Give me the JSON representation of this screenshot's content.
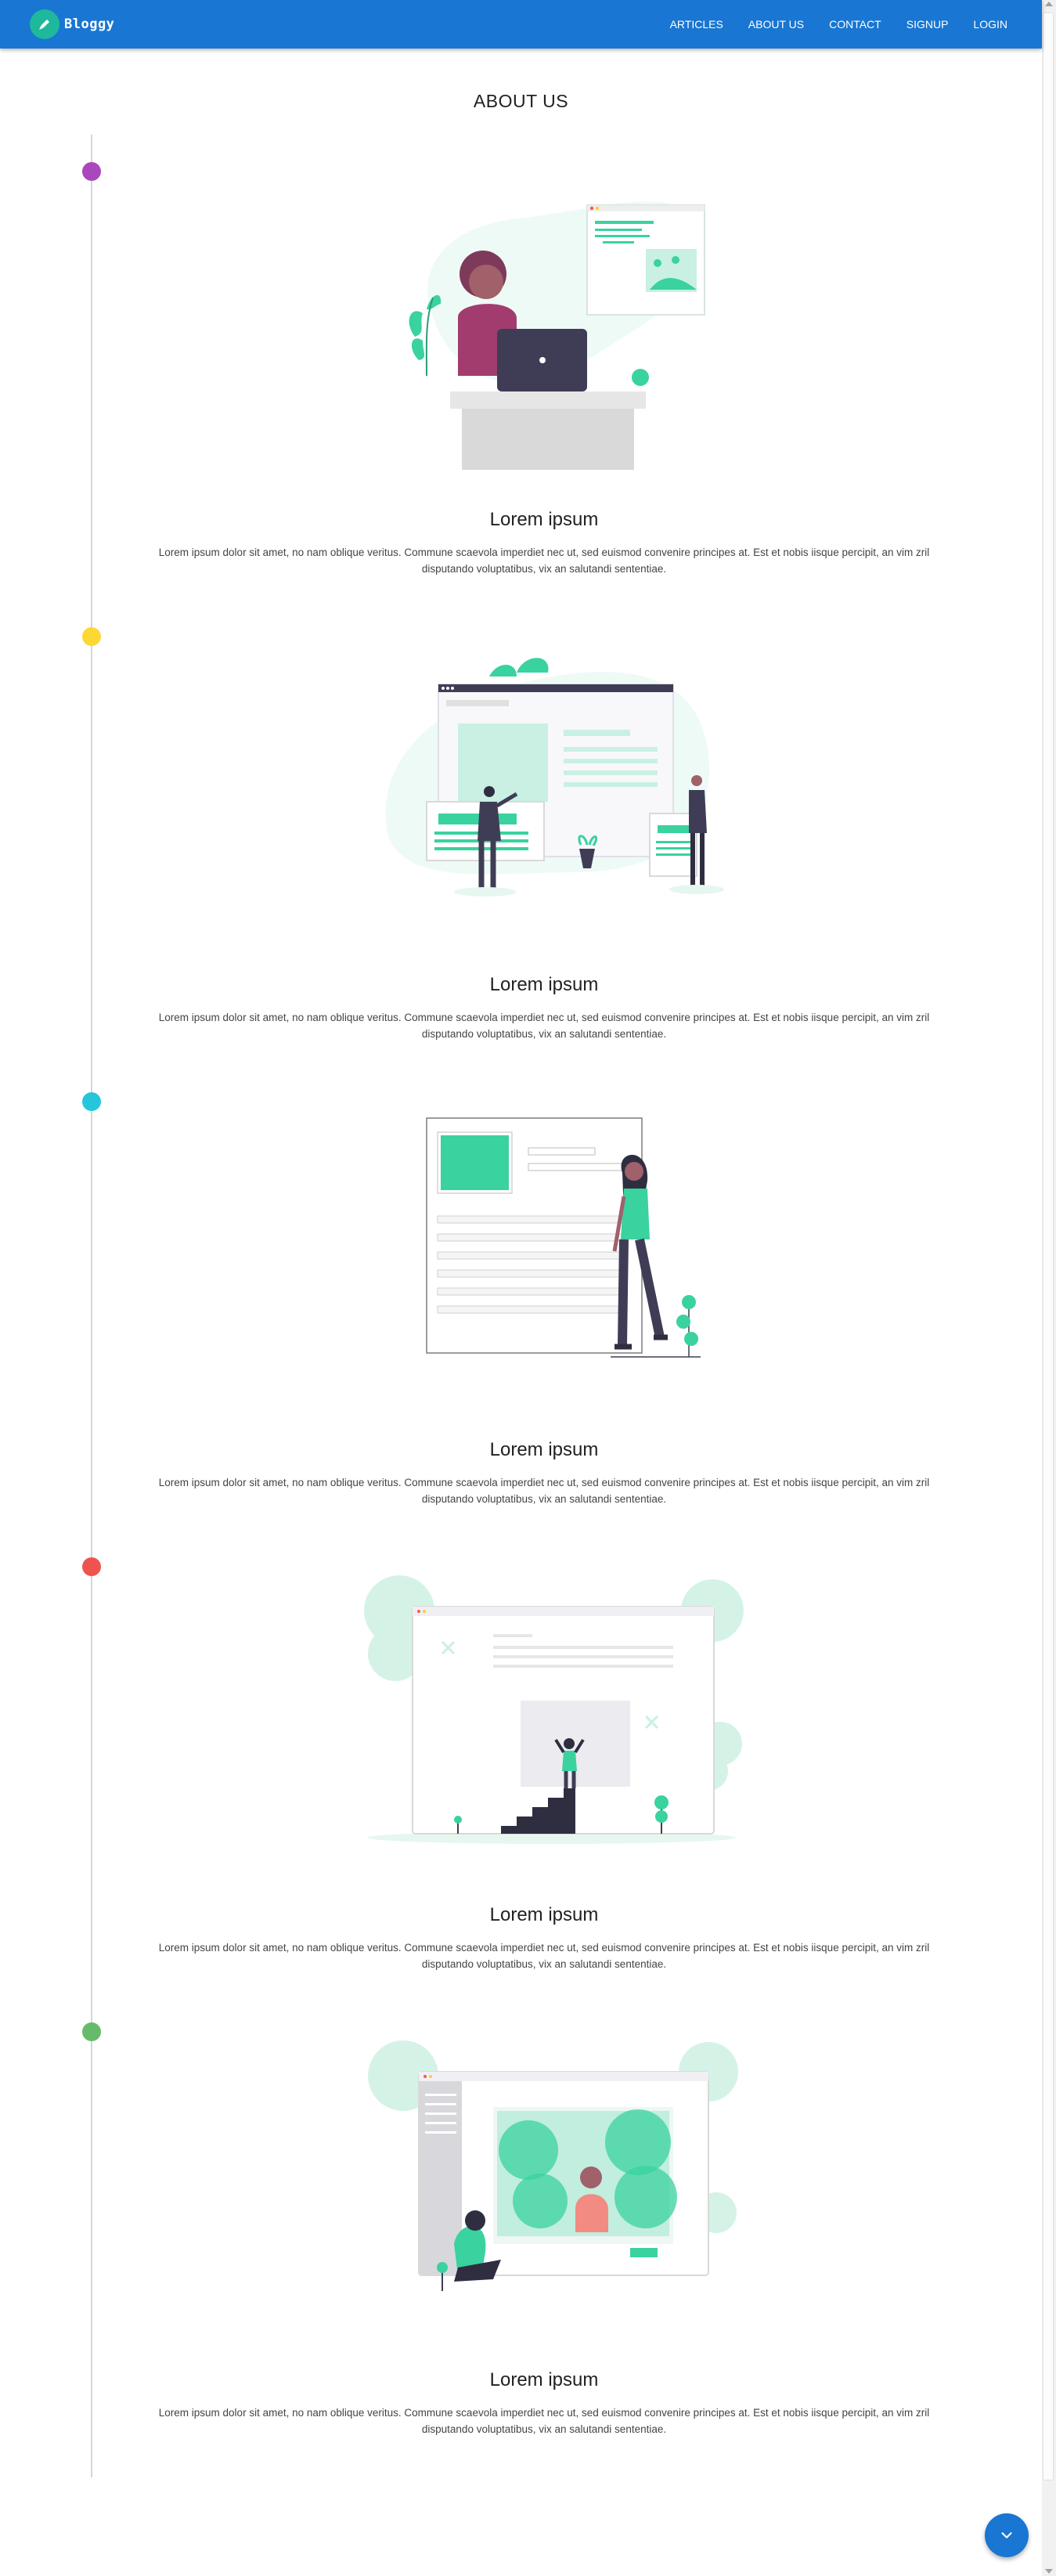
{
  "app": {
    "name": "Bloggy",
    "logo_icon": "pen-icon",
    "accent": "#1976d2",
    "brand_color": "#1fb89c"
  },
  "nav": {
    "items": [
      {
        "label": "ARTICLES"
      },
      {
        "label": "ABOUT US"
      },
      {
        "label": "CONTACT"
      },
      {
        "label": "SIGNUP"
      },
      {
        "label": "LOGIN"
      }
    ]
  },
  "page": {
    "title": "ABOUT US"
  },
  "timeline": {
    "dot_colors": [
      "#ab47bc",
      "#fdd835",
      "#26c6da",
      "#ef5350",
      "#66bb6a"
    ]
  },
  "sections": [
    {
      "heading": "Lorem ipsum",
      "illustration": "woman-working-on-laptop",
      "text": "Lorem ipsum dolor sit amet, no nam oblique veritus. Commune scaevola imperdiet nec ut, sed euismod convenire principes at. Est et nobis iisque percipit, an vim zril disputando voluptatibus, vix an salutandi sententiae."
    },
    {
      "heading": "Lorem ipsum",
      "illustration": "team-building-website",
      "text": "Lorem ipsum dolor sit amet, no nam oblique veritus. Commune scaevola imperdiet nec ut, sed euismod convenire principes at. Est et nobis iisque percipit, an vim zril disputando voluptatibus, vix an salutandi sententiae."
    },
    {
      "heading": "Lorem ipsum",
      "illustration": "woman-with-document-form",
      "text": "Lorem ipsum dolor sit amet, no nam oblique veritus. Commune scaevola imperdiet nec ut, sed euismod convenire principes at. Est et nobis iisque percipit, an vim zril disputando voluptatibus, vix an salutandi sententiae."
    },
    {
      "heading": "Lorem ipsum",
      "illustration": "man-on-top-of-stairs",
      "text": "Lorem ipsum dolor sit amet, no nam oblique veritus. Commune scaevola imperdiet nec ut, sed euismod convenire principes at. Est et nobis iisque percipit, an vim zril disputando voluptatibus, vix an salutandi sententiae."
    },
    {
      "heading": "Lorem ipsum",
      "illustration": "woman-sitting-by-browser-window",
      "text": "Lorem ipsum dolor sit amet, no nam oblique veritus. Commune scaevola imperdiet nec ut, sed euismod convenire principes at. Est et nobis iisque percipit, an vim zril disputando voluptatibus, vix an salutandi sententiae."
    }
  ],
  "fab": {
    "icon": "chevron-down-icon"
  }
}
